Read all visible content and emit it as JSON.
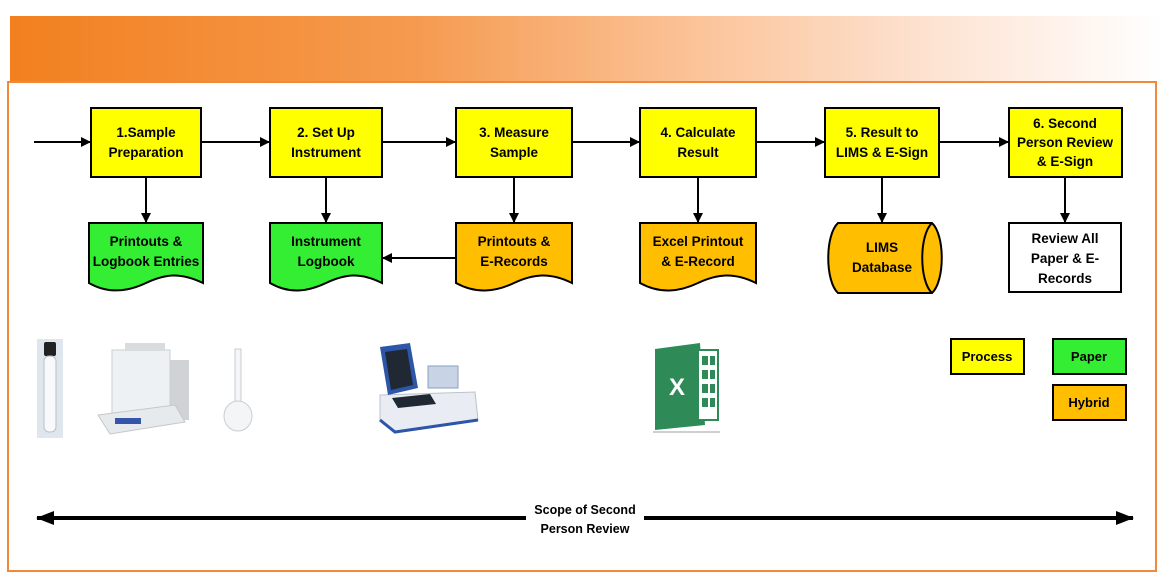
{
  "colors": {
    "process": "#ffff00",
    "paper": "#33ee33",
    "hybrid": "#ffbf00",
    "electronic_review": "#ffffff",
    "banner_start": "#f2801f",
    "frame_border": "#f08a3a"
  },
  "process_steps": [
    {
      "id": "step1",
      "lines": [
        "1.Sample",
        "Preparation"
      ]
    },
    {
      "id": "step2",
      "lines": [
        "2. Set Up",
        "Instrument"
      ]
    },
    {
      "id": "step3",
      "lines": [
        "3. Measure",
        "Sample"
      ]
    },
    {
      "id": "step4",
      "lines": [
        "4. Calculate",
        "Result"
      ]
    },
    {
      "id": "step5",
      "lines": [
        "5. Result to",
        "LIMS & E-Sign"
      ]
    },
    {
      "id": "step6",
      "lines": [
        "6. Second",
        "Person Review",
        "& E-Sign"
      ]
    }
  ],
  "records": [
    {
      "id": "rec1",
      "type": "paper",
      "shape": "document",
      "lines": [
        "Printouts &",
        "Logbook Entries"
      ]
    },
    {
      "id": "rec2",
      "type": "paper",
      "shape": "document",
      "lines": [
        "Instrument",
        "Logbook"
      ]
    },
    {
      "id": "rec3",
      "type": "hybrid",
      "shape": "document",
      "lines": [
        "Printouts &",
        "E-Records"
      ]
    },
    {
      "id": "rec4",
      "type": "hybrid",
      "shape": "document",
      "lines": [
        "Excel Printout",
        "& E-Record"
      ]
    },
    {
      "id": "rec5",
      "type": "hybrid",
      "shape": "database",
      "lines": [
        "LIMS",
        "Database"
      ]
    },
    {
      "id": "rec6",
      "type": "review",
      "shape": "rectangle",
      "lines": [
        "Review All",
        "Paper & E-",
        "Records"
      ]
    }
  ],
  "images": [
    {
      "name": "test-tube-image",
      "label": "Test tube"
    },
    {
      "name": "analytical-balance-image",
      "label": "Analytical balance"
    },
    {
      "name": "volumetric-flask-image",
      "label": "Volumetric flask"
    },
    {
      "name": "spectrophotometer-image",
      "label": "Spectrophotometer"
    },
    {
      "name": "excel-icon",
      "label": "Excel"
    }
  ],
  "legend": [
    {
      "label": "Process",
      "type": "process"
    },
    {
      "label": "Paper",
      "type": "paper"
    },
    {
      "label": "Hybrid",
      "type": "hybrid"
    }
  ],
  "scope": {
    "lines": [
      "Scope of Second",
      "Person Review"
    ]
  }
}
